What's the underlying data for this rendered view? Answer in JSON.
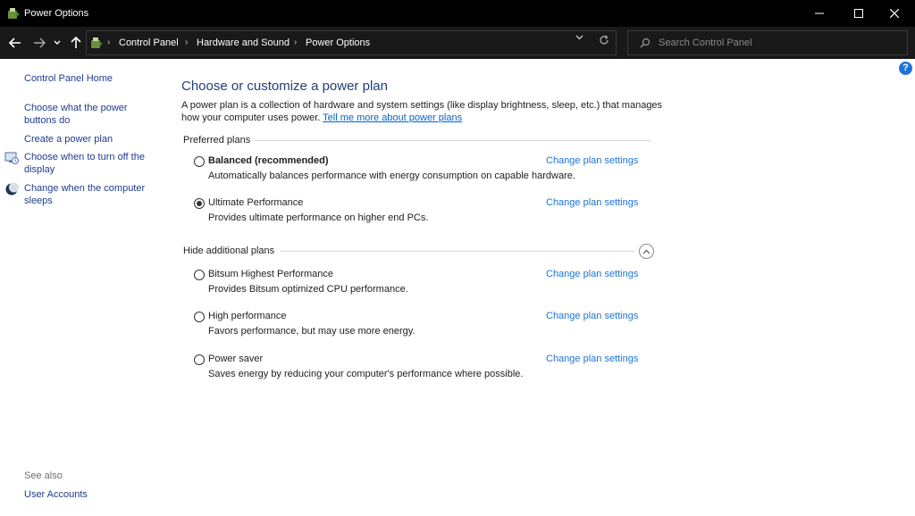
{
  "window": {
    "title": "Power Options",
    "minimize_icon": "minimize-icon",
    "maximize_icon": "maximize-icon",
    "close_icon": "close-icon"
  },
  "address_bar": {
    "breadcrumbs": [
      "Control Panel",
      "Hardware and Sound",
      "Power Options"
    ],
    "search_placeholder": "Search Control Panel"
  },
  "sidebar": {
    "home": "Control Panel Home",
    "links": [
      {
        "label": "Choose what the power buttons do",
        "icon": null
      },
      {
        "label": "Create a power plan",
        "icon": null
      },
      {
        "label": "Choose when to turn off the display",
        "icon": "monitor-icon"
      },
      {
        "label": "Change when the computer sleeps",
        "icon": "moon-icon"
      }
    ],
    "see_also": "See also",
    "see_also_links": [
      "User Accounts"
    ]
  },
  "main": {
    "title": "Choose or customize a power plan",
    "description": "A power plan is a collection of hardware and system settings (like display brightness, sleep, etc.) that manages how your computer uses power.",
    "learn_more": "Tell me more about power plans",
    "preferred_header": "Preferred plans",
    "additional_header": "Hide additional plans",
    "change_link": "Change plan settings",
    "preferred_plans": [
      {
        "name": "Balanced (recommended)",
        "desc": "Automatically balances performance with energy consumption on capable hardware.",
        "selected": false
      },
      {
        "name": "Ultimate Performance",
        "desc": "Provides ultimate performance on higher end PCs.",
        "selected": true
      }
    ],
    "additional_plans": [
      {
        "name": "Bitsum Highest Performance",
        "desc": "Provides Bitsum optimized CPU performance.",
        "selected": false
      },
      {
        "name": "High performance",
        "desc": "Favors performance, but may use more energy.",
        "selected": false
      },
      {
        "name": "Power saver",
        "desc": "Saves energy by reducing your computer's performance where possible.",
        "selected": false
      }
    ]
  },
  "colors": {
    "titlebar": "#000000",
    "addressbar": "#191919",
    "link": "#1e74d6",
    "heading": "#1e3f7a"
  }
}
